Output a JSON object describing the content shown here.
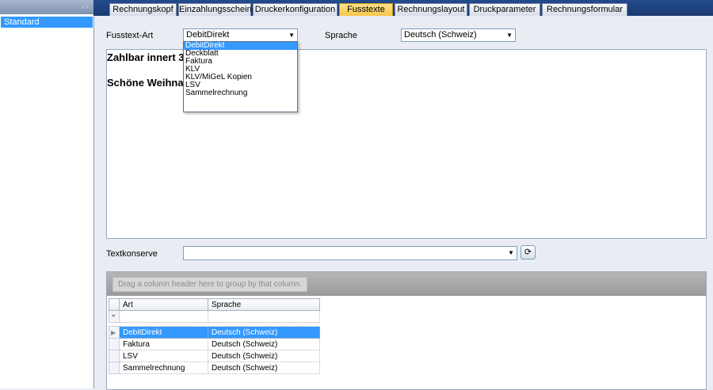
{
  "left_panel": {
    "items": [
      "Standard"
    ]
  },
  "tabs": [
    {
      "label": "Rechnungskopf",
      "active": false
    },
    {
      "label": "Einzahlungsschein",
      "active": false
    },
    {
      "label": "Druckerkonfiguration",
      "active": false
    },
    {
      "label": "Fusstexte",
      "active": true
    },
    {
      "label": "Rechnungslayout",
      "active": false
    },
    {
      "label": "Druckparameter",
      "active": false
    },
    {
      "label": "Rechnungsformular",
      "active": false
    }
  ],
  "form": {
    "fusstext_label": "Fusstext-Art",
    "fusstext_value": "DebitDirekt",
    "sprache_label": "Sprache",
    "sprache_value": "Deutsch (Schweiz)",
    "dropdown_options": [
      "DebitDirekt",
      "Deckblatt",
      "Faktura",
      "KLV",
      "KLV/MiGeL Kopien",
      "LSV",
      "Sammelrechnung"
    ],
    "textkonserve_label": "Textkonserve",
    "textkonserve_value": ""
  },
  "editor": {
    "line1": "Zahlbar innert 3",
    "line2": "Schöne Weihna"
  },
  "grid": {
    "group_hint": "Drag a column header here to group by that column.",
    "columns": [
      "Art",
      "Sprache"
    ],
    "rows": [
      {
        "art": "DebitDirekt",
        "sprache": "Deutsch (Schweiz)",
        "selected": true
      },
      {
        "art": "Faktura",
        "sprache": "Deutsch (Schweiz)",
        "selected": false
      },
      {
        "art": "LSV",
        "sprache": "Deutsch (Schweiz)",
        "selected": false
      },
      {
        "art": "Sammelrechnung",
        "sprache": "Deutsch (Schweiz)",
        "selected": false
      }
    ]
  },
  "icons": {
    "collapse": "double-chevron-left-icon",
    "combo_arrow": "triangle-down-icon",
    "filter": "funnel-icon",
    "row_indicator": "triangle-right-icon",
    "textkonserve_action": "circular-arrow-icon"
  },
  "colors": {
    "selection": "#3399ff",
    "active_tab": "#f8c64a",
    "tab_strip": "#234a8c"
  }
}
